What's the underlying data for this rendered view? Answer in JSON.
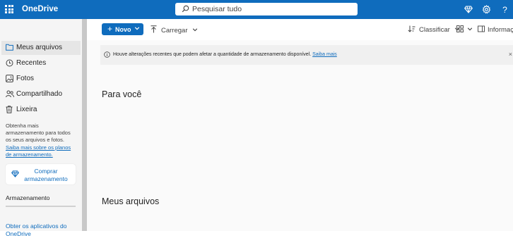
{
  "header": {
    "app_name": "OneDrive",
    "search_placeholder": "Pesquisar tudo",
    "icons": [
      "waffle-icon",
      "premium-diamond-icon",
      "settings-gear-icon",
      "help-icon"
    ],
    "help_glyph": "?"
  },
  "sidebar": {
    "items": [
      {
        "label": "Meus arquivos",
        "icon": "folder-icon",
        "selected": true
      },
      {
        "label": "Recentes",
        "icon": "clock-icon",
        "selected": false
      },
      {
        "label": "Fotos",
        "icon": "image-icon",
        "selected": false
      },
      {
        "label": "Compartilhado",
        "icon": "people-icon",
        "selected": false
      },
      {
        "label": "Lixeira",
        "icon": "trash-icon",
        "selected": false
      }
    ],
    "promo_text": "Obtenha mais armazenamento para todos os seus arquivos e fotos.",
    "promo_link": "Saiba mais sobre os planos de armazenamento.",
    "buy_button": "Comprar armazenamento",
    "storage_label": "Armazenamento",
    "apps_link": "Obter os aplicativos do OneDrive"
  },
  "toolbar": {
    "new_label": "Novo",
    "upload_label": "Carregar",
    "sort_label": "Classificar",
    "info_label": "Informações"
  },
  "banner": {
    "text": "Houve alterações recentes que podem afetar a quantidade de armazenamento disponível.",
    "link": "Saiba mais",
    "close_glyph": "×"
  },
  "main": {
    "section_for_you": "Para você",
    "section_my_files": "Meus arquivos"
  },
  "colors": {
    "accent": "#0f6cbd",
    "sidebar_bg": "#f5f5f5",
    "main_bg": "#fafafa",
    "banner_bg": "#f0f0f0"
  }
}
